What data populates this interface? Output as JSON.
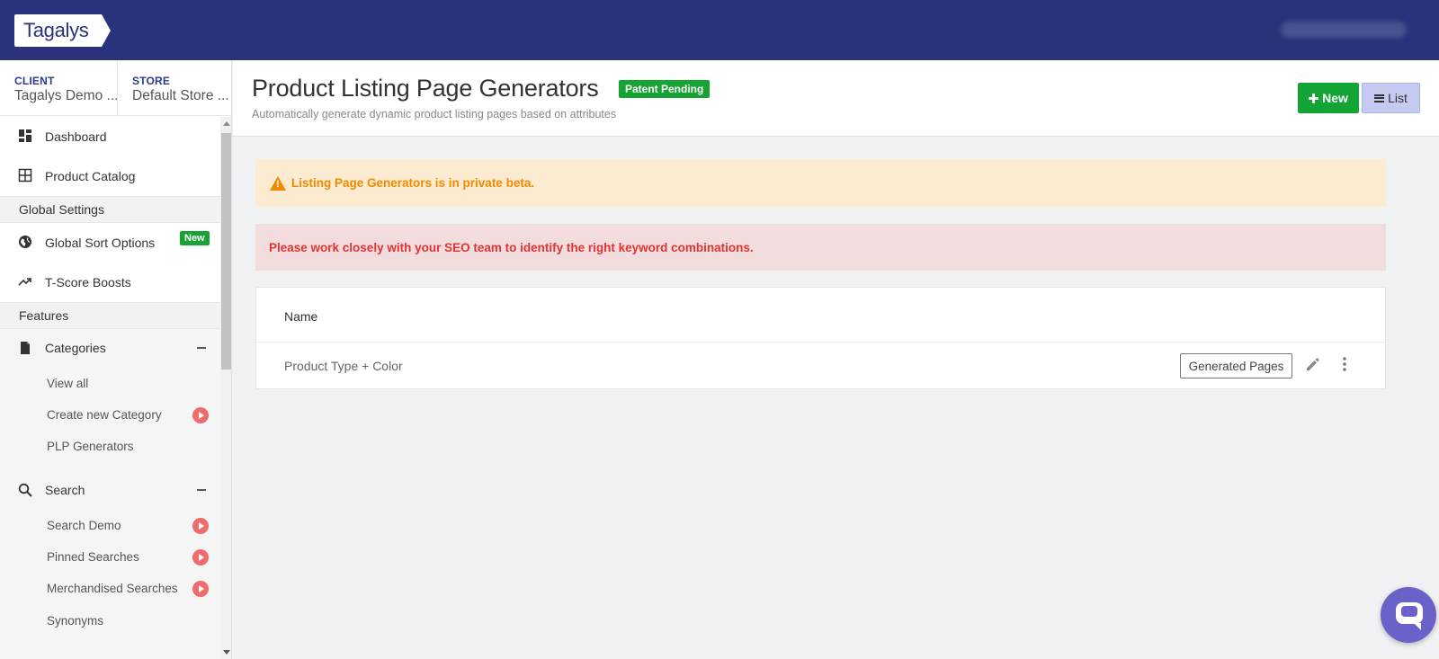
{
  "app": {
    "logo_text": "Tagalys"
  },
  "context": {
    "client_label": "CLIENT",
    "client_value": "Tagalys Demo ...",
    "store_label": "STORE",
    "store_value": "Default Store ..."
  },
  "sidebar": {
    "dashboard": "Dashboard",
    "product_catalog": "Product Catalog",
    "global_settings_header": "Global Settings",
    "global_sort_options": "Global Sort Options",
    "global_sort_badge": "New",
    "tscore_boosts": "T-Score Boosts",
    "features_header": "Features",
    "categories": "Categories",
    "categories_items": [
      "View all",
      "Create new Category",
      "PLP Generators"
    ],
    "search": "Search",
    "search_items": [
      "Search Demo",
      "Pinned Searches",
      "Merchandised Searches",
      "Synonyms"
    ]
  },
  "page": {
    "title": "Product Listing Page Generators",
    "badge": "Patent Pending",
    "subtitle": "Automatically generate dynamic product listing pages based on attributes",
    "new_button": "New",
    "list_button": "List"
  },
  "alerts": {
    "warning": "Listing Page Generators is in private beta.",
    "error": "Please work closely with your SEO team to identify the right keyword combinations."
  },
  "table": {
    "header_name": "Name",
    "rows": [
      {
        "name": "Product Type + Color",
        "action_label": "Generated Pages"
      }
    ]
  },
  "colors": {
    "topbar": "#29327a",
    "accent_green": "#17a333",
    "warning": "#f08a00",
    "error": "#e03434"
  }
}
